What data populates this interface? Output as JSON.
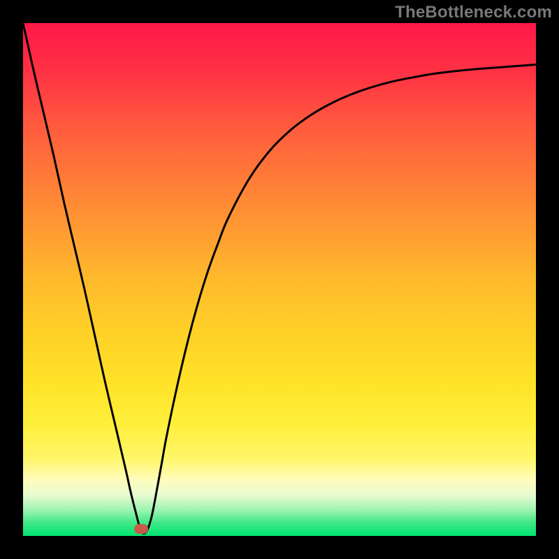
{
  "watermark": "TheBottleneck.com",
  "gradient": {
    "stops": [
      {
        "offset": "0%",
        "color": "#ff1848"
      },
      {
        "offset": "10%",
        "color": "#ff3344"
      },
      {
        "offset": "20%",
        "color": "#ff5a3e"
      },
      {
        "offset": "30%",
        "color": "#ff7a38"
      },
      {
        "offset": "40%",
        "color": "#ff9a32"
      },
      {
        "offset": "50%",
        "color": "#ffba2c"
      },
      {
        "offset": "60%",
        "color": "#ffd028"
      },
      {
        "offset": "70%",
        "color": "#ffe228"
      },
      {
        "offset": "78%",
        "color": "#ffef3a"
      },
      {
        "offset": "85%",
        "color": "#fff66a"
      },
      {
        "offset": "89%",
        "color": "#fffcbb"
      },
      {
        "offset": "92%",
        "color": "#e8fbd0"
      },
      {
        "offset": "95%",
        "color": "#9cf4b0"
      },
      {
        "offset": "97.5%",
        "color": "#3de886"
      },
      {
        "offset": "100%",
        "color": "#00e472"
      }
    ]
  },
  "marker": {
    "x_pct": 23.0,
    "y_pct": 99.0
  },
  "chart_data": {
    "type": "line",
    "title": "",
    "xlabel": "",
    "ylabel": "",
    "xlim": [
      0,
      100
    ],
    "ylim": [
      0,
      100
    ],
    "grid": false,
    "legend": false,
    "annotations": [
      "TheBottleneck.com"
    ],
    "series": [
      {
        "name": "curve",
        "x": [
          0,
          2,
          4,
          6,
          8,
          10,
          12,
          14,
          16,
          18,
          20,
          21,
          22,
          23,
          24,
          25,
          26,
          27,
          28,
          30,
          32,
          34,
          36,
          38,
          40,
          44,
          48,
          52,
          56,
          60,
          64,
          68,
          72,
          76,
          80,
          84,
          88,
          92,
          96,
          100
        ],
        "y": [
          100,
          91,
          82.5,
          74,
          65,
          56.5,
          48,
          39,
          30,
          21.5,
          13,
          8.5,
          4.5,
          1.0,
          0.8,
          3.5,
          8.5,
          14,
          19.5,
          29,
          37.5,
          45,
          51.5,
          57,
          62,
          69.5,
          75,
          79,
          82,
          84.3,
          86.1,
          87.5,
          88.6,
          89.4,
          90.1,
          90.6,
          91,
          91.3,
          91.6,
          91.9
        ]
      }
    ],
    "marker_point": {
      "x": 23.0,
      "y": 1.0
    },
    "background_gradient": "green (bottom) → yellow → orange → red (top)"
  }
}
